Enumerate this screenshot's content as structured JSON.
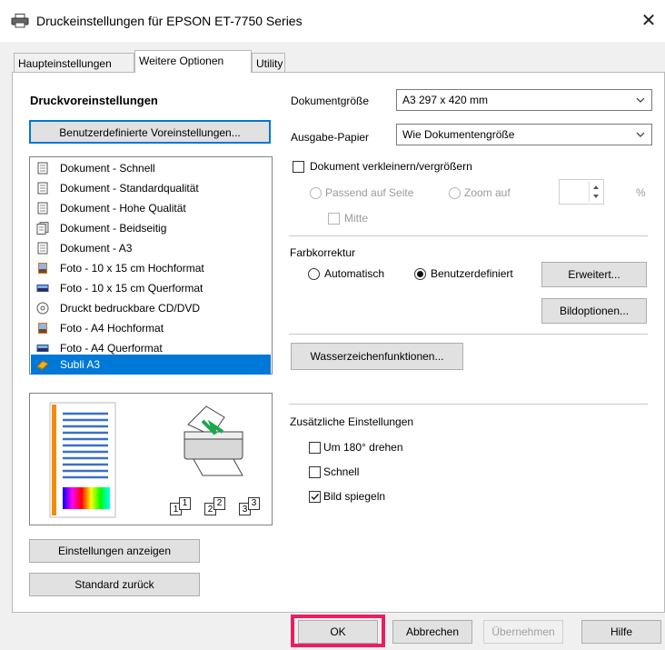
{
  "window": {
    "title": "Druckeinstellungen für EPSON ET-7750 Series"
  },
  "tabs": [
    {
      "label": "Haupteinstellungen"
    },
    {
      "label": "Weitere Optionen"
    },
    {
      "label": "Utility"
    }
  ],
  "presets": {
    "heading": "Druckvoreinstellungen",
    "custom_button": "Benutzerdefinierte Voreinstellungen...",
    "items": [
      {
        "label": "Dokument - Schnell",
        "icon": "document-icon"
      },
      {
        "label": "Dokument - Standardqualität",
        "icon": "document-icon"
      },
      {
        "label": "Dokument - Hohe Qualität",
        "icon": "document-icon"
      },
      {
        "label": "Dokument - Beidseitig",
        "icon": "duplex-document-icon"
      },
      {
        "label": "Dokument - A3",
        "icon": "document-icon"
      },
      {
        "label": "Foto - 10 x 15 cm Hochformat",
        "icon": "photo-portrait-icon"
      },
      {
        "label": "Foto - 10 x 15 cm Querformat",
        "icon": "photo-landscape-icon"
      },
      {
        "label": "Druckt bedruckbare CD/DVD",
        "icon": "disc-icon"
      },
      {
        "label": "Foto - A4 Hochformat",
        "icon": "photo-portrait-icon"
      },
      {
        "label": "Foto - A4 Querformat",
        "icon": "photo-landscape-icon"
      },
      {
        "label": "Subli A3",
        "icon": "custom-preset-icon"
      }
    ],
    "selected_index": 10,
    "show_settings_button": "Einstellungen anzeigen",
    "reset_button": "Standard zurück"
  },
  "preview": {
    "copy_numbers": [
      "1",
      "1",
      "2",
      "2",
      "3",
      "3"
    ]
  },
  "document_size": {
    "label": "Dokumentgröße",
    "value": "A3 297 x 420 mm"
  },
  "output_paper": {
    "label": "Ausgabe-Papier",
    "value": "Wie Dokumentengröße"
  },
  "reduce_enlarge": {
    "label": "Dokument verkleinern/vergrößern",
    "checked": false,
    "fit_to_page": "Passend auf Seite",
    "zoom": "Zoom auf",
    "zoom_value": "",
    "percent": "%",
    "center": "Mitte"
  },
  "color_correction": {
    "heading": "Farbkorrektur",
    "auto": "Automatisch",
    "custom": "Benutzerdefiniert",
    "selected": "custom",
    "advanced_button": "Erweitert...",
    "image_options_button": "Bildoptionen..."
  },
  "watermark_button": "Wasserzeichenfunktionen...",
  "extra": {
    "heading": "Zusätzliche Einstellungen",
    "rotate": {
      "label": "Um 180° drehen",
      "checked": false
    },
    "fast": {
      "label": "Schnell",
      "checked": false
    },
    "mirror": {
      "label": "Bild spiegeln",
      "checked": true
    }
  },
  "footer": {
    "ok": "OK",
    "cancel": "Abbrechen",
    "apply": "Übernehmen",
    "help": "Hilfe"
  },
  "colors": {
    "selection": "#0078d7",
    "highlight": "#e91e63",
    "preview_accent": "#f28c00"
  }
}
